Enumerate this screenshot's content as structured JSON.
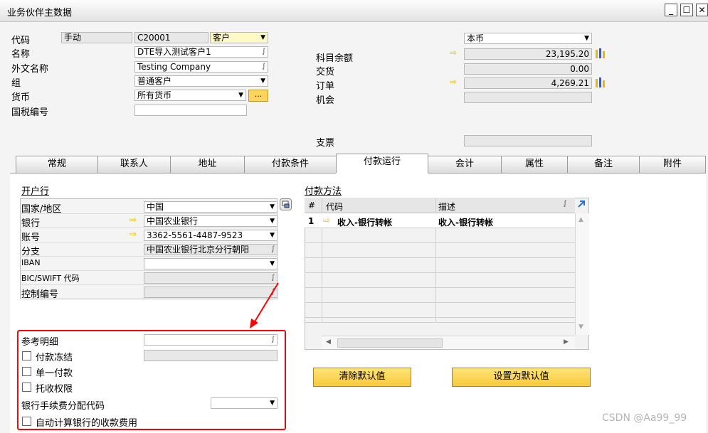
{
  "window": {
    "title": "业务伙伴主数据"
  },
  "header": {
    "code_label": "代码",
    "code_mode": "手动",
    "code_value": "C20001",
    "type_value": "客户",
    "name_label": "名称",
    "name_value": "DTE导入测试客户1",
    "foreign_name_label": "外文名称",
    "foreign_name_value": "Testing Company",
    "group_label": "组",
    "group_value": "普通客户",
    "currency_label": "货币",
    "currency_value": "所有货币",
    "currency_button": "...",
    "tax_id_label": "国税编号",
    "tax_id_value": "",
    "local_currency_value": "本币",
    "account_balance_label": "科目余额",
    "account_balance_value": "23,195.20",
    "deliveries_label": "交货",
    "deliveries_value": "0.00",
    "orders_label": "订单",
    "orders_value": "4,269.21",
    "opportunities_label": "机会",
    "opportunities_value": "",
    "checks_label": "支票",
    "checks_value": ""
  },
  "tabs": [
    "常规",
    "联系人",
    "地址",
    "付款条件",
    "付款运行",
    "会计",
    "属性",
    "备注",
    "附件"
  ],
  "active_tab": "付款运行",
  "bank_section": {
    "title": "开户行",
    "rows": [
      {
        "label": "国家/地区",
        "value": "中国",
        "control": "dropdown"
      },
      {
        "label": "银行",
        "value": "中国农业银行",
        "control": "dropdown"
      },
      {
        "label": "账号",
        "value": "3362-5561-4487-9523",
        "control": "dropdown"
      },
      {
        "label": "分支",
        "value": "中国农业银行北京分行朝阳",
        "control": "lens"
      },
      {
        "label": "IBAN",
        "value": "",
        "control": "dropdown"
      },
      {
        "label": "BIC/SWIFT 代码",
        "value": "",
        "control": "lens"
      },
      {
        "label": "控制编号",
        "value": "",
        "control": "lens"
      }
    ]
  },
  "payment_methods": {
    "title": "付款方法",
    "columns": [
      "#",
      "代码",
      "描述"
    ],
    "rows": [
      {
        "num": "1",
        "code": "收入-银行转帐",
        "description": "收入-银行转帐"
      }
    ],
    "clear_default_button": "清除默认值",
    "set_default_button": "设置为默认值"
  },
  "options": {
    "reference_details_label": "参考明细",
    "reference_details_value": "",
    "payment_block_label": "付款冻结",
    "single_payment_label": "单一付款",
    "collection_authorization_label": "托收权限",
    "bank_charges_code_label": "银行手续费分配代码",
    "bank_charges_code_value": "",
    "auto_calc_bank_fees_label": "自动计算银行的收款费用"
  },
  "watermark": "CSDN @Aa99_99",
  "colors": {
    "highlight": "#ff0000",
    "accent_arrow": "#e9b800",
    "button": "#f8c93b"
  }
}
